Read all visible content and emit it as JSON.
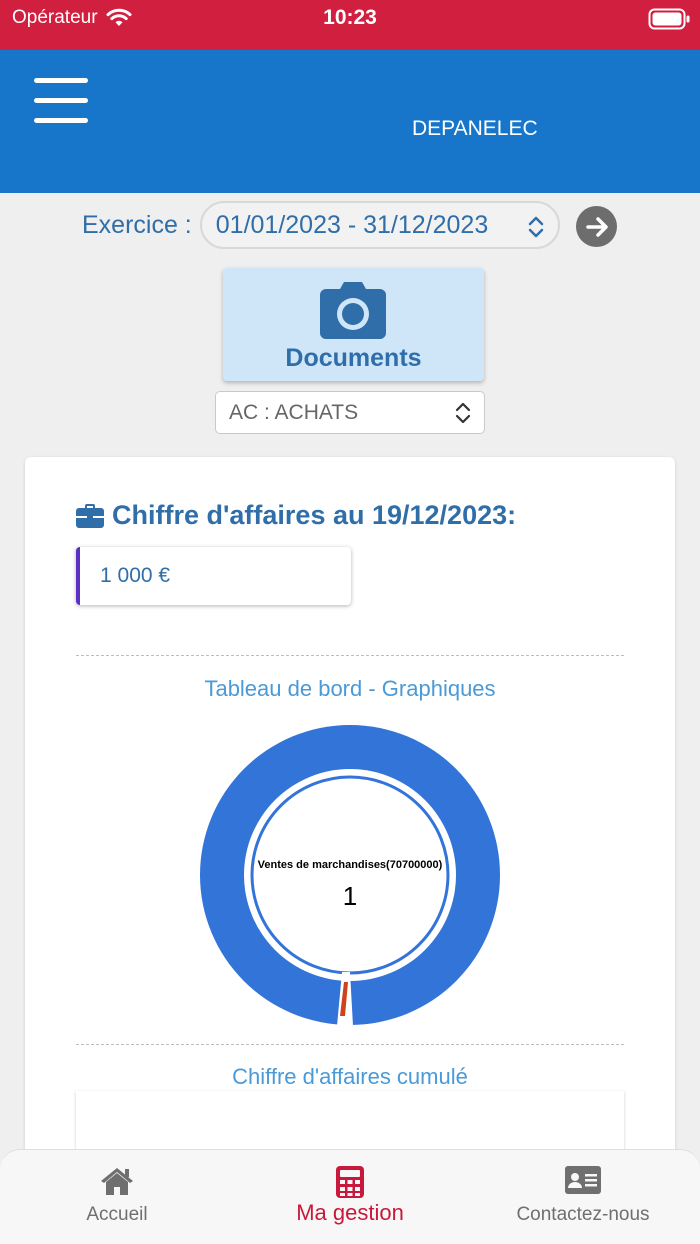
{
  "status_bar": {
    "carrier": "Opérateur",
    "time": "10:23"
  },
  "header": {
    "company": "DEPANELEC"
  },
  "exercice": {
    "label": "Exercice :",
    "value": "01/01/2023 - 31/12/2023"
  },
  "documents_button": {
    "label": "Documents"
  },
  "journal_select": {
    "value": "AC : ACHATS"
  },
  "card": {
    "ca_title": "Chiffre d'affaires au 19/12/2023:",
    "ca_value": "1 000 €",
    "dashboard_title": "Tableau de bord - Graphiques",
    "cumulative_title": "Chiffre d'affaires cumulé"
  },
  "chart_data": {
    "type": "pie",
    "title": "",
    "center_label": "Ventes de marchandises(70700000)",
    "center_value": "1",
    "series": [
      {
        "name": "Ventes de marchandises(70700000)",
        "values": [
          1
        ],
        "color": "#3374d9"
      }
    ]
  },
  "tabs": [
    {
      "label": "Accueil",
      "icon": "home-icon",
      "active": false
    },
    {
      "label": "Ma gestion",
      "icon": "calculator-icon",
      "active": true
    },
    {
      "label": "Contactez-nous",
      "icon": "contact-card-icon",
      "active": false
    }
  ],
  "colors": {
    "status_bar": "#d11f3f",
    "app_bar": "#1776c9",
    "accent_text": "#2f6ea8",
    "active_tab": "#c8193c",
    "donut": "#3374d9",
    "donut_marker": "#d0421b"
  }
}
